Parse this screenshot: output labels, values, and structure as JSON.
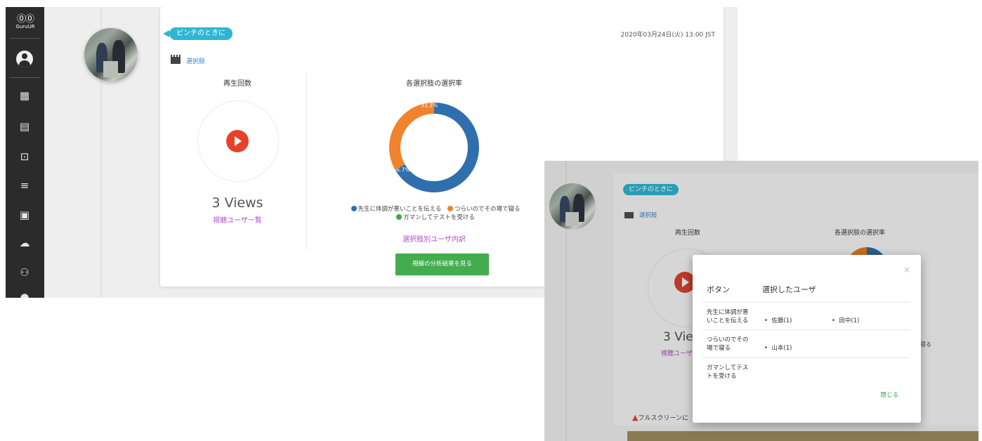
{
  "sidebar": {
    "logo_glyph": "⓪⓪",
    "logo_text": "GuruUR",
    "icons": [
      "account-icon",
      "dashboard-icon",
      "library-icon",
      "cast-icon",
      "playlist-icon",
      "clipboard-icon",
      "cloud-upload-icon",
      "users-icon",
      "help-icon"
    ]
  },
  "card": {
    "tag": "ピンチのときに",
    "datetime": "2020年03月24日(火) 13:00 JST",
    "choice_link": "選択肢",
    "play_title": "再生回数",
    "views": "3 Views",
    "viewer_link": "視聴ユーザ一覧",
    "chart_title": "各選択肢の選択率",
    "breakdown_link": "選択肢別ユーザ内訳",
    "analysis_button": "視線の分析結果を見る"
  },
  "chart_data": {
    "type": "pie",
    "title": "各選択肢の選択率",
    "slices": [
      {
        "label": "先生に体調が悪いことを伝える",
        "value": 66.7,
        "color": "#2f6fad",
        "data_label": "66.7%"
      },
      {
        "label": "つらいのでその場で寝る",
        "value": 33.3,
        "color": "#f0832b",
        "data_label": "33.3%"
      },
      {
        "label": "ガマンしてテストを受ける",
        "value": 0,
        "color": "#3aa845",
        "data_label": ""
      }
    ],
    "donut": true,
    "legend_position": "bottom"
  },
  "modal_view": {
    "tag": "ピンチのときに",
    "choice_link": "選択肢",
    "play_title": "再生回数",
    "chart_title": "各選択肢の選択率",
    "views_partial": "3 Vie",
    "viewer_partial": "視聴ユーザ",
    "peek_text": "で寝る",
    "warning": "フルスクリーンに",
    "modal": {
      "close_x": "×",
      "col_button": "ボタン",
      "col_users": "選択したユーザ",
      "rows": [
        {
          "label": "先生に体調が悪いことを伝える",
          "users": [
            "佐藤(1)",
            "田中(1)"
          ]
        },
        {
          "label": "つらいのでその場で寝る",
          "users": [
            "山本(1)"
          ]
        },
        {
          "label": "ガマンしてテストを受ける",
          "users": []
        }
      ],
      "close_button": "閉じる"
    }
  }
}
